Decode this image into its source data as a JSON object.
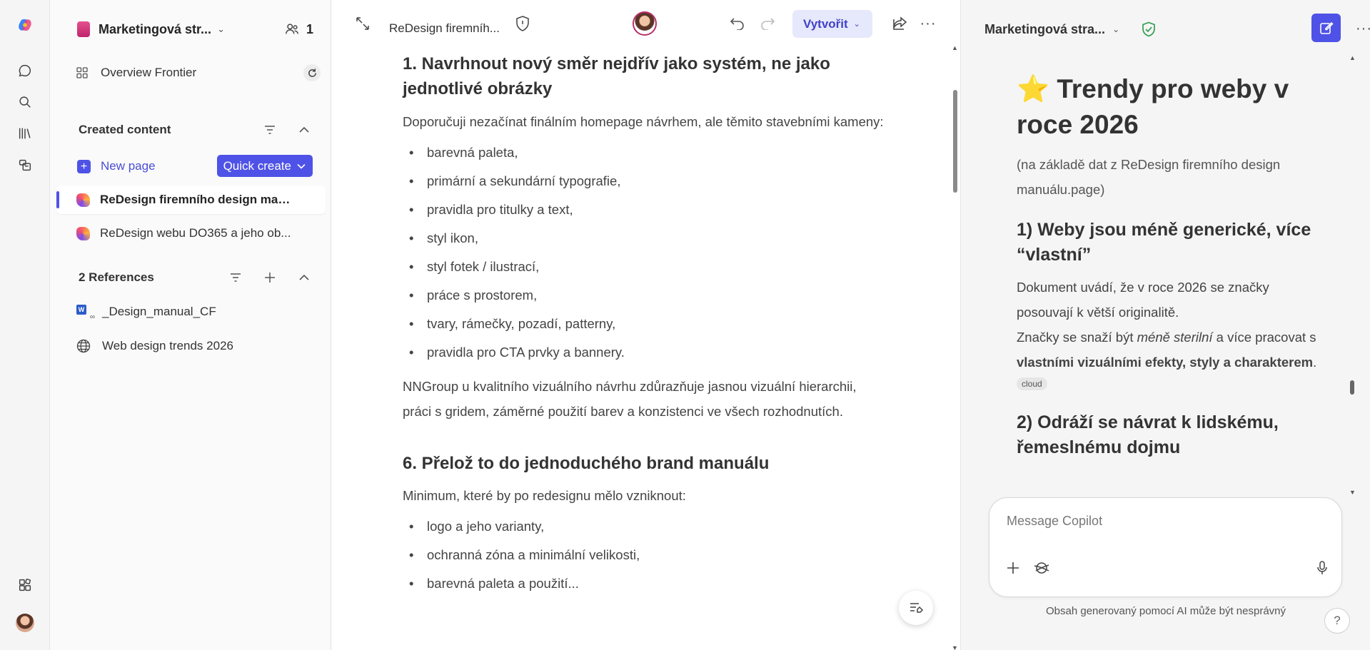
{
  "nav": {
    "notebook_title": "Marketingová str...",
    "member_count": "1",
    "overview_label": "Overview Frontier",
    "created_content_heading": "Created content",
    "new_page_label": "New page",
    "quick_create_label": "Quick create",
    "pages": [
      {
        "label": "ReDesign firemního design man..."
      },
      {
        "label": "ReDesign webu DO365 a jeho ob..."
      }
    ],
    "references_heading": "2 References",
    "references": [
      {
        "label": "_Design_manual_CF",
        "icon": "word-link-icon"
      },
      {
        "label": "Web design trends 2026",
        "icon": "globe-icon"
      }
    ]
  },
  "doc": {
    "title": "ReDesign firemníh...",
    "create_label": "Vytvořit",
    "section1_heading": "1. Navrhnout nový směr nejdřív jako systém, ne jako jednotlivé obrázky",
    "section1_intro": "Doporučuji nezačínat finálním homepage návrhem, ale těmito stavebními kameny:",
    "section1_items": [
      "barevná paleta,",
      "primární a sekundární typografie,",
      "pravidla pro titulky a text,",
      "styl ikon,",
      "styl fotek / ilustrací,",
      "práce s prostorem,",
      "tvary, rámečky, pozadí, patterny,",
      "pravidla pro CTA prvky a bannery."
    ],
    "section1_outro": "NNGroup u kvalitního vizuálního návrhu zdůrazňuje jasnou vizuální hierarchii, práci s gridem, záměrné použití barev a konzistenci ve všech rozhodnutích.",
    "section6_heading": "6. Přelož to do jednoduchého brand manuálu",
    "section6_intro": "Minimum, které by po redesignu mělo vzniknout:",
    "section6_items": [
      "logo a jeho varianty,",
      "ochranná zóna a minimální velikosti,",
      "barevná paleta a použití..."
    ]
  },
  "copilot": {
    "notebook_title": "Marketingová stra...",
    "heading": "⭐ Trendy pro weby v roce 2026",
    "subtitle": "(na základě dat z ReDesign firemního design manuálu.page)",
    "trend1_heading": "1) Weby jsou méně generické, více “vlastní”",
    "trend1_p1": "Dokument uvádí, že v roce 2026 se značky posouvají k větší originalitě.",
    "trend1_p2_a": "Značky se snaží být ",
    "trend1_p2_em": "méně sterilní",
    "trend1_p2_b": " a více pracovat s ",
    "trend1_p2_strong": "vlastními vizuálními efekty, styly a charakterem",
    "trend1_p2_c": ".",
    "trend1_tag": "cloud",
    "trend2_heading": "2) Odráží se návrat k lidskému, řemeslnému dojmu",
    "message_placeholder": "Message Copilot",
    "disclaimer": "Obsah generovaný pomocí AI může být nesprávný",
    "help_label": "?"
  },
  "colors": {
    "accent": "#4f52e6",
    "accent_light": "#e6e8fb",
    "shield_green": "#2e9e4f"
  }
}
